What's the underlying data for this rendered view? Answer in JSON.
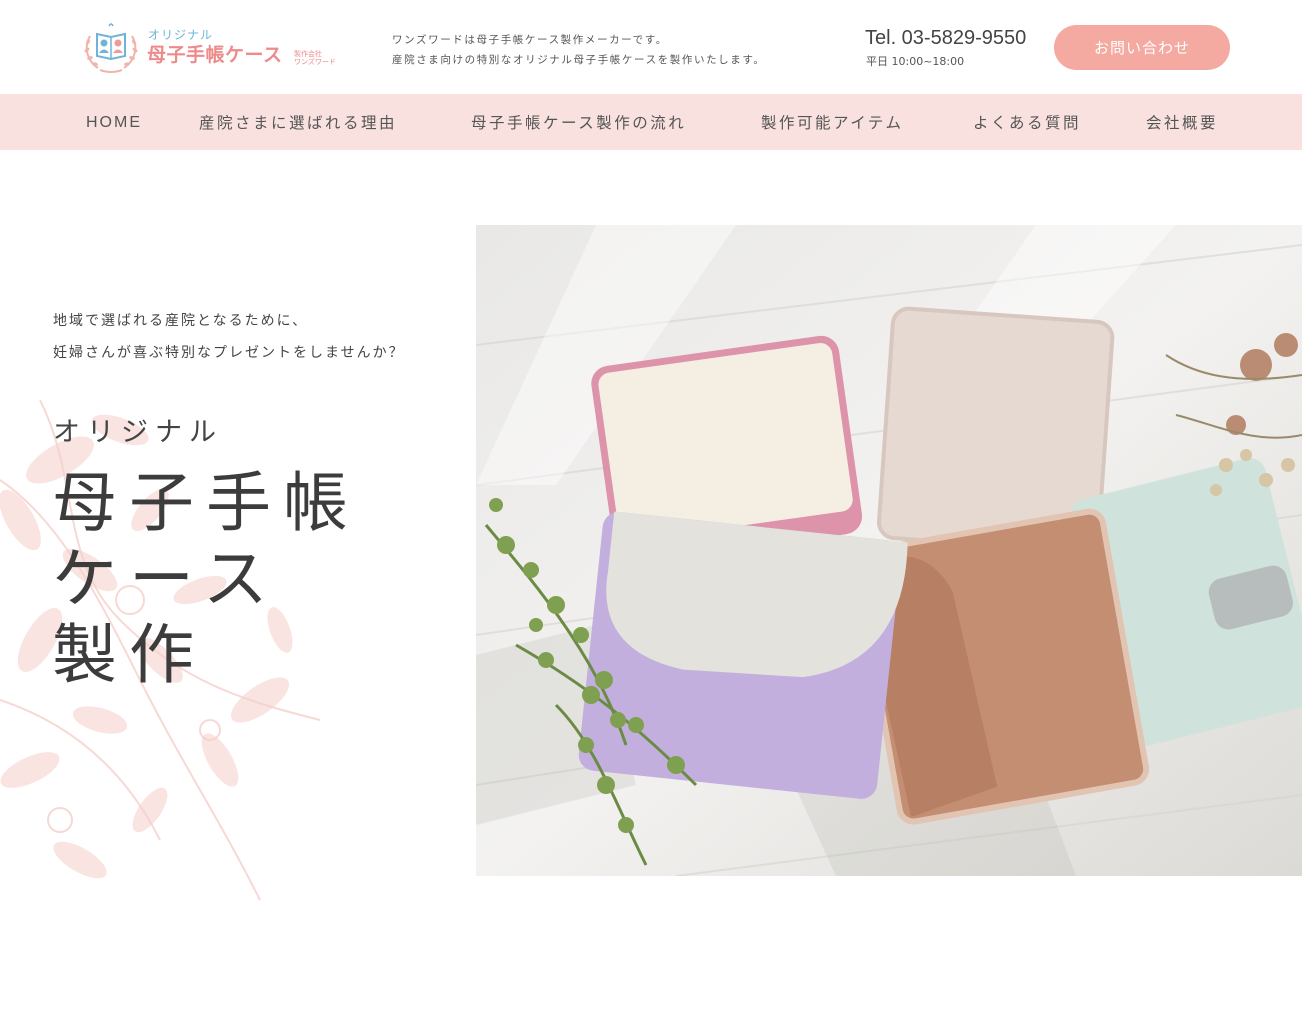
{
  "header": {
    "logo": {
      "sub": "オリジナル",
      "main": "母子手帳ケース",
      "tag_line1": "製作会社",
      "tag_line2": "ワンズワード"
    },
    "description": {
      "line1": "ワンズワードは母子手帳ケース製作メーカーです。",
      "line2": "産院さま向けの特別なオリジナル母子手帳ケースを製作いたします。"
    },
    "tel": "Tel. 03-5829-9550",
    "hours": "平日 10:00~18:00",
    "contact_label": "お問い合わせ"
  },
  "nav": {
    "items": [
      {
        "label": "HOME"
      },
      {
        "label": "産院さまに選ばれる理由"
      },
      {
        "label": "母子手帳ケース製作の流れ"
      },
      {
        "label": "製作可能アイテム"
      },
      {
        "label": "よくある質問"
      },
      {
        "label": "会社概要"
      }
    ]
  },
  "hero": {
    "lead_line1": "地域で選ばれる産院となるために、",
    "lead_line2": "妊婦さんが喜ぶ特別なプレゼントをしませんか？",
    "kicker": "オリジナル",
    "title_line1": "母子手帳",
    "title_line2": "ケース",
    "title_line3": "製作"
  },
  "colors": {
    "accent_pink": "#f4aaa0",
    "nav_background": "#f9e1e0",
    "logo_pink": "#ee8a8a",
    "logo_blue": "#6fb4d8"
  },
  "icons": [
    "logo-emblem-icon",
    "floral-decoration-icon"
  ]
}
